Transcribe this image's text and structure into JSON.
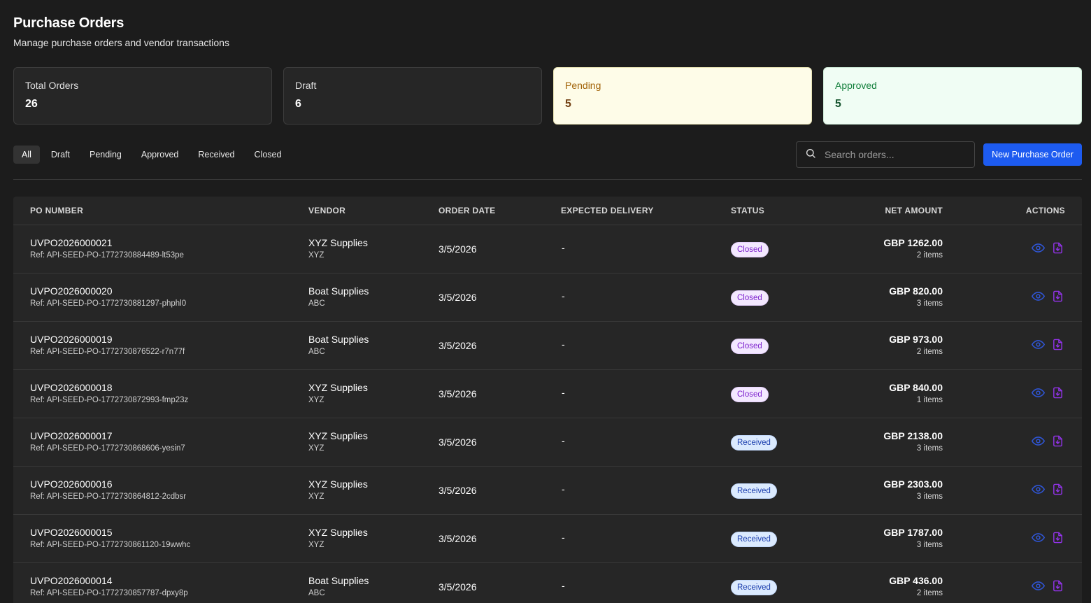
{
  "header": {
    "title": "Purchase Orders",
    "subtitle": "Manage purchase orders and vendor transactions"
  },
  "stats": [
    {
      "label": "Total Orders",
      "value": "26"
    },
    {
      "label": "Draft",
      "value": "6"
    },
    {
      "label": "Pending",
      "value": "5"
    },
    {
      "label": "Approved",
      "value": "5"
    }
  ],
  "filters": {
    "tabs": [
      "All",
      "Draft",
      "Pending",
      "Approved",
      "Received",
      "Closed"
    ],
    "active": "All"
  },
  "search": {
    "placeholder": "Search orders...",
    "value": ""
  },
  "new_button_label": "New Purchase Order",
  "table": {
    "columns": {
      "po_number": "PO NUMBER",
      "vendor": "VENDOR",
      "order_date": "ORDER DATE",
      "expected_delivery": "EXPECTED DELIVERY",
      "status": "STATUS",
      "net_amount": "NET AMOUNT",
      "actions": "ACTIONS"
    },
    "rows": [
      {
        "po": "UVPO2026000021",
        "ref": "Ref: API-SEED-PO-1772730884489-lt53pe",
        "vendor": "XYZ Supplies",
        "vendor_code": "XYZ",
        "date": "3/5/2026",
        "delivery": "-",
        "status": "Closed",
        "amount": "GBP 1262.00",
        "items": "2 items"
      },
      {
        "po": "UVPO2026000020",
        "ref": "Ref: API-SEED-PO-1772730881297-phphl0",
        "vendor": "Boat Supplies",
        "vendor_code": "ABC",
        "date": "3/5/2026",
        "delivery": "-",
        "status": "Closed",
        "amount": "GBP 820.00",
        "items": "3 items"
      },
      {
        "po": "UVPO2026000019",
        "ref": "Ref: API-SEED-PO-1772730876522-r7n77f",
        "vendor": "Boat Supplies",
        "vendor_code": "ABC",
        "date": "3/5/2026",
        "delivery": "-",
        "status": "Closed",
        "amount": "GBP 973.00",
        "items": "2 items"
      },
      {
        "po": "UVPO2026000018",
        "ref": "Ref: API-SEED-PO-1772730872993-fmp23z",
        "vendor": "XYZ Supplies",
        "vendor_code": "XYZ",
        "date": "3/5/2026",
        "delivery": "-",
        "status": "Closed",
        "amount": "GBP 840.00",
        "items": "1 items"
      },
      {
        "po": "UVPO2026000017",
        "ref": "Ref: API-SEED-PO-1772730868606-yesin7",
        "vendor": "XYZ Supplies",
        "vendor_code": "XYZ",
        "date": "3/5/2026",
        "delivery": "-",
        "status": "Received",
        "amount": "GBP 2138.00",
        "items": "3 items"
      },
      {
        "po": "UVPO2026000016",
        "ref": "Ref: API-SEED-PO-1772730864812-2cdbsr",
        "vendor": "XYZ Supplies",
        "vendor_code": "XYZ",
        "date": "3/5/2026",
        "delivery": "-",
        "status": "Received",
        "amount": "GBP 2303.00",
        "items": "3 items"
      },
      {
        "po": "UVPO2026000015",
        "ref": "Ref: API-SEED-PO-1772730861120-19wwhc",
        "vendor": "XYZ Supplies",
        "vendor_code": "XYZ",
        "date": "3/5/2026",
        "delivery": "-",
        "status": "Received",
        "amount": "GBP 1787.00",
        "items": "3 items"
      },
      {
        "po": "UVPO2026000014",
        "ref": "Ref: API-SEED-PO-1772730857787-dpxy8p",
        "vendor": "Boat Supplies",
        "vendor_code": "ABC",
        "date": "3/5/2026",
        "delivery": "-",
        "status": "Received",
        "amount": "GBP 436.00",
        "items": "2 items"
      }
    ]
  },
  "icons": {
    "view": "eye-icon",
    "download": "file-download-icon",
    "search": "search-icon"
  },
  "colors": {
    "primary": "#1d5bf0",
    "view_icon": "#2f55d4",
    "download_icon": "#9333ea"
  }
}
